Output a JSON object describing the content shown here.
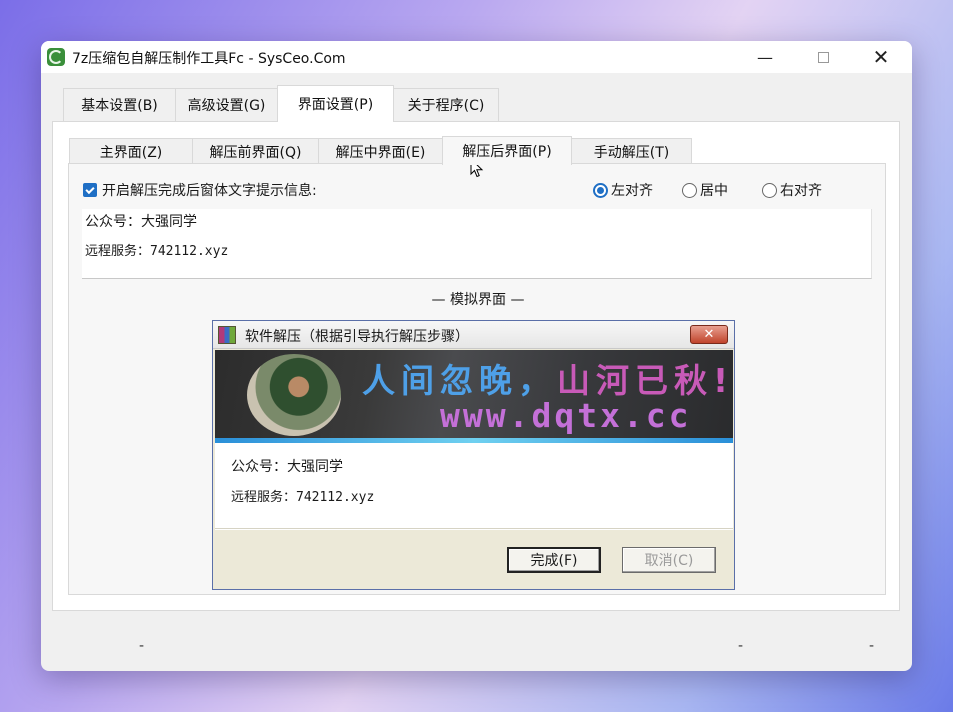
{
  "window": {
    "title": "7z压缩包自解压制作工具Fc - SysCeo.Com",
    "min_glyph": "—",
    "close_glyph": "✕"
  },
  "main_tabs": [
    {
      "label": "基本设置(B)",
      "active": false
    },
    {
      "label": "高级设置(G)",
      "active": false
    },
    {
      "label": "界面设置(P)",
      "active": true
    },
    {
      "label": "关于程序(C)",
      "active": false
    }
  ],
  "sub_tabs": [
    {
      "label": "主界面(Z)",
      "active": false
    },
    {
      "label": "解压前界面(Q)",
      "active": false
    },
    {
      "label": "解压中界面(E)",
      "active": false
    },
    {
      "label": "解压后界面(P)",
      "active": true
    },
    {
      "label": "手动解压(T)",
      "active": false
    }
  ],
  "options": {
    "enable_text_label": "开启解压完成后窗体文字提示信息:",
    "enable_text_checked": true,
    "align_options": [
      {
        "label": "左对齐",
        "selected": true
      },
      {
        "label": "居中",
        "selected": false
      },
      {
        "label": "右对齐",
        "selected": false
      }
    ]
  },
  "textbox": {
    "line1": "公众号：大强同学",
    "line2": "远程服务：742112.xyz"
  },
  "preview": {
    "label": "— 模拟界面 —",
    "title": "软件解压（根据引导执行解压步骤）",
    "close_glyph": "✕",
    "banner_line1_a": "人间忽晚，",
    "banner_line1_b": "山河已秋!",
    "banner_line2": "www.dqtx.cc",
    "body_line1": "公众号：大强同学",
    "body_line2": "远程服务：742112.xyz",
    "ok_button": "完成(F)",
    "cancel_button": "取消(C)"
  },
  "status": {
    "dash1": "-",
    "dash2": "-",
    "dash3": "-"
  },
  "colors": {
    "accent": "#1f6fc5",
    "banner_blue": "#4ea0e8",
    "banner_magenta": "#c85ab8"
  }
}
